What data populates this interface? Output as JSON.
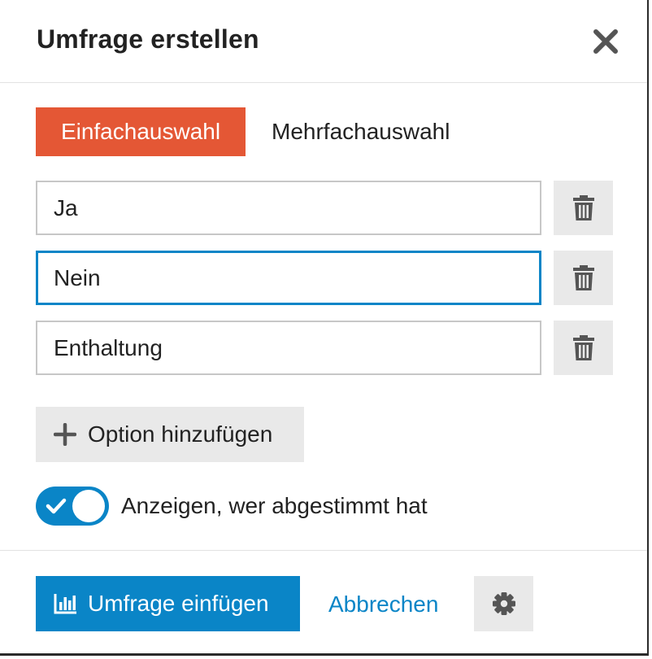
{
  "modal": {
    "title": "Umfrage erstellen"
  },
  "tabs": [
    {
      "label": "Einfachauswahl",
      "active": true
    },
    {
      "label": "Mehrfachauswahl",
      "active": false
    }
  ],
  "options": [
    {
      "value": "Ja"
    },
    {
      "value": "Nein",
      "focused": true
    },
    {
      "value": "Enthaltung"
    }
  ],
  "add_option": {
    "label": "Option hinzufügen"
  },
  "toggle": {
    "label": "Anzeigen, wer abgestimmt hat",
    "checked": true
  },
  "footer": {
    "insert_label": "Umfrage einfügen",
    "cancel_label": "Abbrechen"
  },
  "colors": {
    "accent": "#e45735",
    "primary": "#0a85c7",
    "button_gray": "#e9e9e9",
    "text": "#222222",
    "icon_gray": "#555555"
  },
  "icons": {
    "close": "close-icon",
    "delete": "trash-icon",
    "add": "plus-icon",
    "toggle_check": "check-icon",
    "insert": "bar-chart-icon",
    "settings": "gear-icon"
  }
}
